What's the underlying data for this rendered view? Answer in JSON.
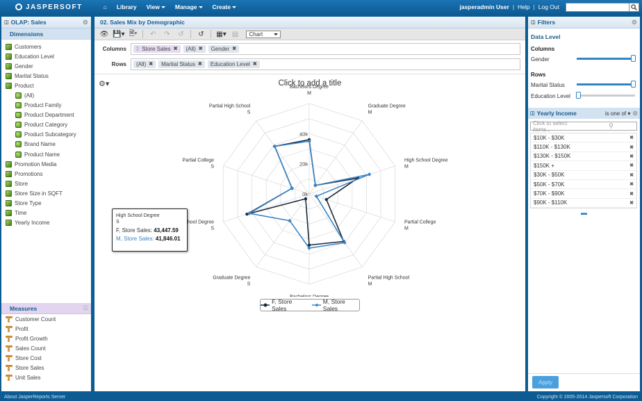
{
  "topbar": {
    "logo": "JASPERSOFT",
    "menu": [
      "Library",
      "View",
      "Manage",
      "Create"
    ],
    "user": "jasperadmin User",
    "help": "Help",
    "logout": "Log Out",
    "search_placeholder": ""
  },
  "left": {
    "title": "OLAP: Sales",
    "dimensions_label": "Dimensions",
    "dimensions": [
      {
        "label": "Customers",
        "level": 0
      },
      {
        "label": "Education Level",
        "level": 0
      },
      {
        "label": "Gender",
        "level": 0
      },
      {
        "label": "Marital Status",
        "level": 0
      },
      {
        "label": "Product",
        "level": 0
      },
      {
        "label": "(All)",
        "level": 1
      },
      {
        "label": "Product Family",
        "level": 1
      },
      {
        "label": "Product Department",
        "level": 1
      },
      {
        "label": "Product Category",
        "level": 1
      },
      {
        "label": "Product Subcategory",
        "level": 1
      },
      {
        "label": "Brand Name",
        "level": 1
      },
      {
        "label": "Product Name",
        "level": 1
      },
      {
        "label": "Promotion Media",
        "level": 0
      },
      {
        "label": "Promotions",
        "level": 0
      },
      {
        "label": "Store",
        "level": 0
      },
      {
        "label": "Store Size in SQFT",
        "level": 0
      },
      {
        "label": "Store Type",
        "level": 0
      },
      {
        "label": "Time",
        "level": 0
      },
      {
        "label": "Yearly Income",
        "level": 0
      }
    ],
    "measures_label": "Measures",
    "measures": [
      "Customer Count",
      "Profit",
      "Profit Growth",
      "Sales Count",
      "Store Cost",
      "Store Sales",
      "Unit Sales"
    ]
  },
  "center": {
    "title": "02. Sales Mix by Demographic",
    "chart_type": "Chart",
    "columns_label": "Columns",
    "rows_label": "Rows",
    "columns": [
      "Store Sales",
      "(All)",
      "Gender"
    ],
    "rows": [
      "(All)",
      "Marital Status",
      "Education Level"
    ],
    "add_title": "Click to add a title",
    "tooltip": {
      "line1": "High School Degree",
      "line2": "S",
      "f_label": "F, Store Sales:",
      "f_value": "43,447.59",
      "m_label": "M, Store Sales:",
      "m_value": "41,846.01"
    }
  },
  "chart_data": {
    "type": "radar",
    "categories": [
      [
        "Bachelors Degree",
        "M"
      ],
      [
        "Graduate Degree",
        "M"
      ],
      [
        "High School Degree",
        "M"
      ],
      [
        "Partial College",
        "M"
      ],
      [
        "Partial High School",
        "M"
      ],
      [
        "Bachelors Degree",
        "S"
      ],
      [
        "Graduate Degree",
        "S"
      ],
      [
        "High School Degree",
        "S"
      ],
      [
        "Partial College",
        "S"
      ],
      [
        "Partial High School",
        "S"
      ]
    ],
    "series": [
      {
        "name": "F, Store Sales",
        "color": "#1a2a3a",
        "values": [
          36000,
          7000,
          34000,
          12000,
          39000,
          34000,
          4000,
          43447.59,
          12000,
          39000
        ]
      },
      {
        "name": "M, Store Sales",
        "color": "#3b84c4",
        "values": [
          35000,
          7000,
          42000,
          5000,
          40000,
          36000,
          22000,
          41846.01,
          12000,
          39000
        ]
      }
    ],
    "tick_labels": [
      "0k",
      "20k",
      "40k"
    ],
    "ylim": [
      0,
      60000
    ],
    "legend": "bottom"
  },
  "right": {
    "title": "Filters",
    "data_level": "Data Level",
    "columns_label": "Columns",
    "columns": [
      {
        "label": "Gender",
        "value": 1.0
      }
    ],
    "rows_label": "Rows",
    "rows": [
      {
        "label": "Marital Status",
        "value": 1.0
      },
      {
        "label": "Education Level",
        "value": 0.0
      }
    ],
    "yearly_income": {
      "label": "Yearly Income",
      "op": "is one of",
      "placeholder": "Click to select items...",
      "items": [
        "$10K - $30K",
        "$110K - $130K",
        "$130K - $150K",
        "$150K +",
        "$30K - $50K",
        "$50K - $70K",
        "$70K - $90K",
        "$90K - $110K"
      ]
    },
    "apply": "Apply"
  },
  "footer": {
    "left": "About JasperReports Server",
    "right": "Copyright © 2005-2014 Jaspersoft Corporation"
  }
}
